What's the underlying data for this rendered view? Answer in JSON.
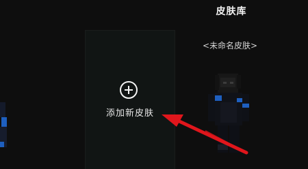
{
  "header": {
    "title": "皮肤库"
  },
  "add_card": {
    "label": "添加新皮肤",
    "icon": "plus-circle-icon"
  },
  "skin_card": {
    "name": "<未命名皮肤>"
  },
  "colors": {
    "background": "#0e0e0e",
    "card": "#111514",
    "text": "#f2f2f2",
    "arrow": "#e0161c",
    "skin_accent": "#1e5fbf"
  }
}
